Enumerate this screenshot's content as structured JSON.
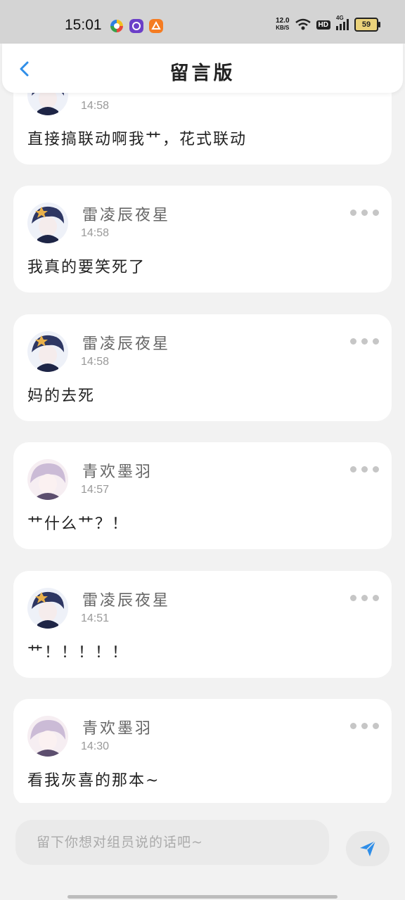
{
  "status_bar": {
    "time": "15:01",
    "net_speed": "12.0",
    "net_unit": "KB/S",
    "hd": "HD",
    "signal": "4G",
    "battery": "59"
  },
  "header": {
    "title": "留言版"
  },
  "messages": [
    {
      "author": "",
      "time": "14:58",
      "content": "直接搞联动啊我艹，花式联动",
      "avatar": "avatar-blue"
    },
    {
      "author": "雷凌辰夜星",
      "time": "14:58",
      "content": "我真的要笑死了",
      "avatar": "avatar-blue"
    },
    {
      "author": "雷凌辰夜星",
      "time": "14:58",
      "content": "妈的去死",
      "avatar": "avatar-blue"
    },
    {
      "author": "青欢墨羽",
      "time": "14:57",
      "content": "艹什么艹？！",
      "avatar": "avatar-pink"
    },
    {
      "author": "雷凌辰夜星",
      "time": "14:51",
      "content": "艹！！！！！",
      "avatar": "avatar-blue"
    },
    {
      "author": "青欢墨羽",
      "time": "14:30",
      "content": "看我灰喜的那本~",
      "avatar": "avatar-pink"
    }
  ],
  "input": {
    "placeholder": "留下你想对组员说的话吧~",
    "value": ""
  },
  "colors": {
    "accent": "#2f8ee8",
    "background": "#f2f2f2"
  }
}
